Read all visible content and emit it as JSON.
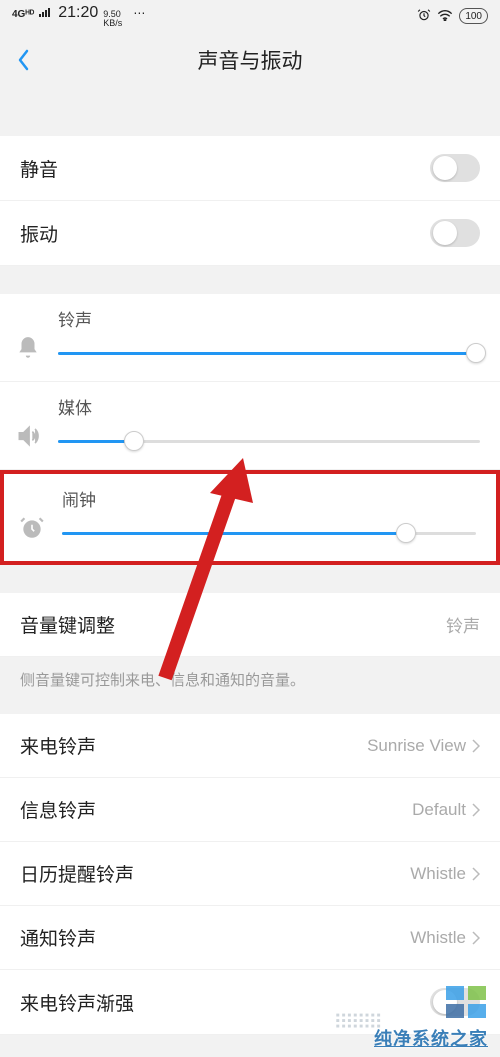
{
  "status": {
    "network": "4Gᴴᴰ",
    "time": "21:20",
    "speed_num": "9.50",
    "speed_unit": "KB/s",
    "dots": "⋯",
    "battery": "100"
  },
  "nav": {
    "title": "声音与振动"
  },
  "toggles": {
    "mute_label": "静音",
    "vibrate_label": "振动"
  },
  "sliders": {
    "ringtone": {
      "label": "铃声",
      "value": 99
    },
    "media": {
      "label": "媒体",
      "value": 18
    },
    "alarm": {
      "label": "闹钟",
      "value": 83
    }
  },
  "volume_key": {
    "label": "音量键调整",
    "value": "铃声",
    "help": "侧音量键可控制来电、信息和通知的音量。"
  },
  "ringtones": {
    "incoming": {
      "label": "来电铃声",
      "value": "Sunrise View"
    },
    "message": {
      "label": "信息铃声",
      "value": "Default"
    },
    "calendar": {
      "label": "日历提醒铃声",
      "value": "Whistle"
    },
    "notification": {
      "label": "通知铃声",
      "value": "Whistle"
    },
    "crescendo": {
      "label": "来电铃声渐强"
    }
  },
  "watermark": {
    "text": "纯净系统之家"
  }
}
